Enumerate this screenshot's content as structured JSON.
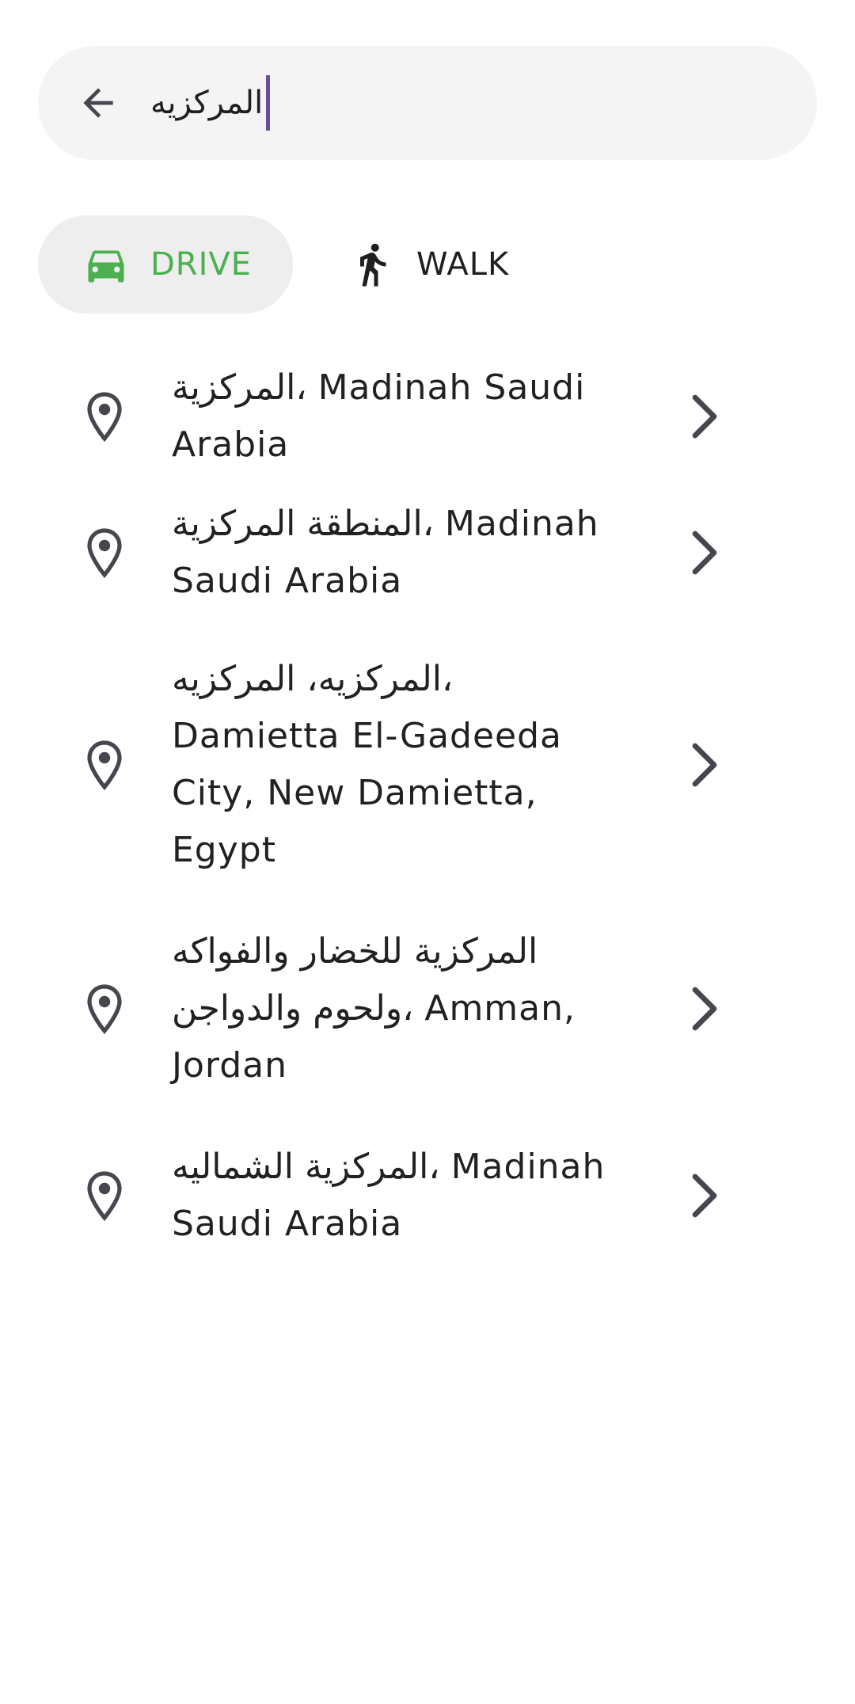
{
  "search": {
    "value": "المركزيه"
  },
  "modes": {
    "drive_label": "DRIVE",
    "walk_label": "WALK"
  },
  "results": [
    {
      "label": "المركزية، Madinah Saudi Arabia"
    },
    {
      "label": "المنطقة المركزية، Madinah Saudi Arabia"
    },
    {
      "label": "المركزيه، المركزيه، Damietta El-Gadeeda City, New Damietta, Egypt"
    },
    {
      "label": "المركزية للخضار والفواكه ولحوم والدواجن، Amman, Jordan"
    },
    {
      "label": "المركزية الشماليه، Madinah Saudi Arabia"
    }
  ],
  "colors": {
    "accent_green": "#4caf50",
    "caret_purple": "#6a4ea3",
    "icon_gray": "#49454f"
  },
  "icons": {
    "back": "arrow-left-icon",
    "drive": "car-icon",
    "walk": "walking-person-icon",
    "result": "location-pin-icon",
    "result_action": "chevron-right-icon"
  }
}
